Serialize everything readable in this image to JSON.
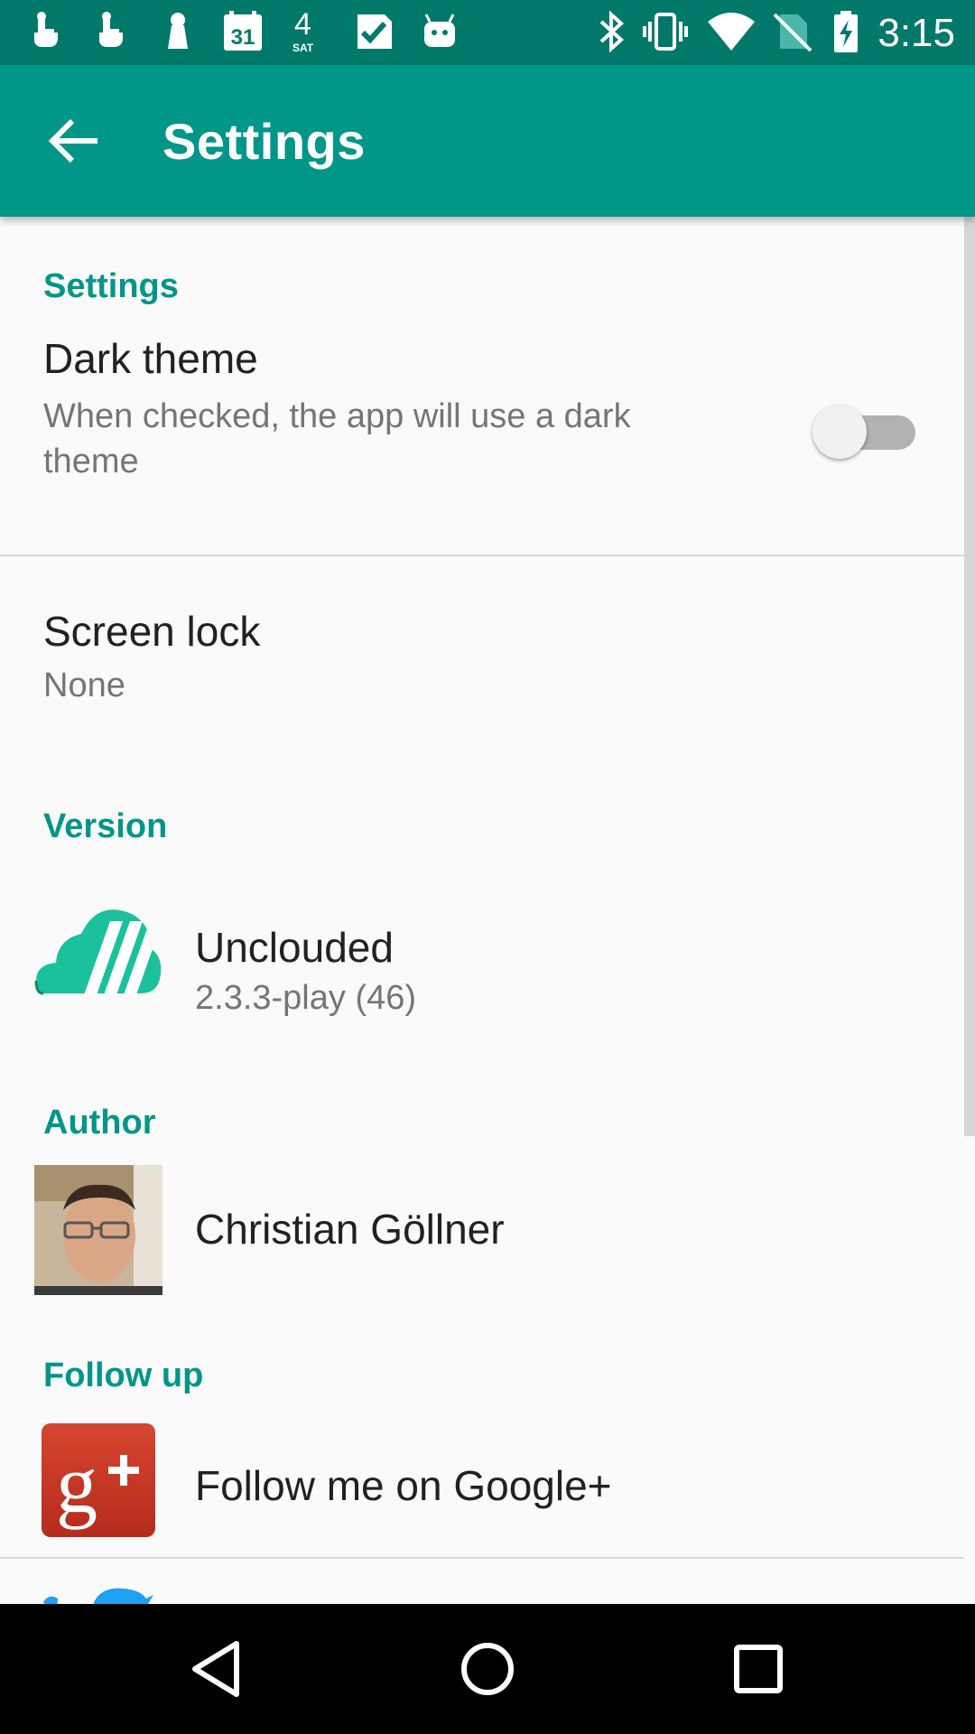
{
  "status_bar": {
    "time": "3:15",
    "calendar_day": "31",
    "weather_day_num": "4",
    "weather_day_label": "SAT",
    "left_icons": [
      "gesture-icon",
      "gesture-icon",
      "keyhole-icon",
      "calendar-icon",
      "weather-icon",
      "check-icon",
      "android-icon"
    ],
    "right_icons": [
      "bluetooth-icon",
      "vibrate-icon",
      "wifi-icon",
      "no-sim-icon",
      "battery-charging-icon"
    ]
  },
  "app_bar": {
    "title": "Settings",
    "color": "#009688",
    "status_color": "#00796b"
  },
  "sections": {
    "settings_header": "Settings",
    "dark_theme": {
      "title": "Dark theme",
      "summary": "When checked, the app will use a dark theme",
      "checked": false
    },
    "screen_lock": {
      "title": "Screen lock",
      "summary": "None"
    },
    "version_header": "Version",
    "version": {
      "title": "Unclouded",
      "summary": "2.3.3-play (46)"
    },
    "author_header": "Author",
    "author": {
      "name": "Christian Göllner"
    },
    "followup_header": "Follow up",
    "google_plus": {
      "title": "Follow me on Google+"
    }
  },
  "accent_color": "#009688",
  "nav_bar": {
    "buttons": [
      "back-icon",
      "home-icon",
      "recents-icon"
    ]
  }
}
